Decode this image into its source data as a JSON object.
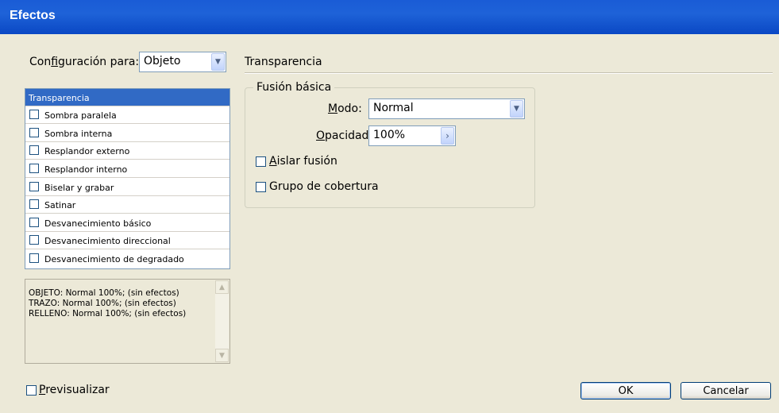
{
  "window": {
    "title": "Efectos"
  },
  "settings": {
    "label_pre": "Con",
    "label_accel": "f",
    "label_post": "iguración para:",
    "value": "Objeto"
  },
  "effects_list": {
    "items": [
      {
        "label": "Transparencia",
        "selected": true,
        "has_checkbox": false
      },
      {
        "label": "Sombra paralela",
        "checked": false
      },
      {
        "label": "Sombra interna",
        "checked": false
      },
      {
        "label": "Resplandor externo",
        "checked": false
      },
      {
        "label": "Resplandor interno",
        "checked": false
      },
      {
        "label": "Biselar y grabar",
        "checked": false
      },
      {
        "label": "Satinar",
        "checked": false
      },
      {
        "label": "Desvanecimiento básico",
        "checked": false
      },
      {
        "label": "Desvanecimiento direccional",
        "checked": false
      },
      {
        "label": "Desvanecimiento de degradado",
        "checked": false
      }
    ]
  },
  "summary": {
    "lines": [
      "OBJETO: Normal 100%; (sin efectos)",
      "TRAZO: Normal 100%; (sin efectos)",
      "RELLENO: Normal 100%; (sin efectos)"
    ]
  },
  "panel": {
    "title": "Transparencia",
    "group_title": "Fusión básica",
    "mode_label_accel": "M",
    "mode_label_rest": "odo:",
    "mode_value": "Normal",
    "opacity_label_accel": "O",
    "opacity_label_rest": "pacidad:",
    "opacity_value": "100%",
    "isolate_accel": "A",
    "isolate_rest": "islar fusión",
    "isolate_checked": false,
    "knockout_label": "Grupo de cobertura",
    "knockout_checked": false
  },
  "footer": {
    "preview_accel": "P",
    "preview_rest": "revisualizar",
    "preview_checked": false,
    "ok_label": "OK",
    "cancel_label": "Cancelar"
  },
  "colors": {
    "titlebar": "#0a48c4",
    "selection": "#316ac5",
    "dialog_bg": "#ece9d8"
  }
}
